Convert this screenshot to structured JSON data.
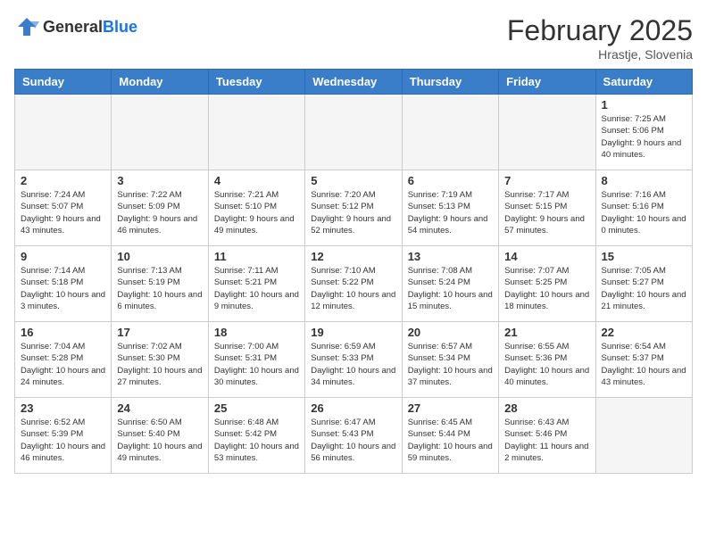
{
  "header": {
    "logo": {
      "general": "General",
      "blue": "Blue"
    },
    "title": "February 2025",
    "location": "Hrastje, Slovenia"
  },
  "weekdays": [
    "Sunday",
    "Monday",
    "Tuesday",
    "Wednesday",
    "Thursday",
    "Friday",
    "Saturday"
  ],
  "weeks": [
    [
      {
        "day": "",
        "info": ""
      },
      {
        "day": "",
        "info": ""
      },
      {
        "day": "",
        "info": ""
      },
      {
        "day": "",
        "info": ""
      },
      {
        "day": "",
        "info": ""
      },
      {
        "day": "",
        "info": ""
      },
      {
        "day": "1",
        "info": "Sunrise: 7:25 AM\nSunset: 5:06 PM\nDaylight: 9 hours and 40 minutes."
      }
    ],
    [
      {
        "day": "2",
        "info": "Sunrise: 7:24 AM\nSunset: 5:07 PM\nDaylight: 9 hours and 43 minutes."
      },
      {
        "day": "3",
        "info": "Sunrise: 7:22 AM\nSunset: 5:09 PM\nDaylight: 9 hours and 46 minutes."
      },
      {
        "day": "4",
        "info": "Sunrise: 7:21 AM\nSunset: 5:10 PM\nDaylight: 9 hours and 49 minutes."
      },
      {
        "day": "5",
        "info": "Sunrise: 7:20 AM\nSunset: 5:12 PM\nDaylight: 9 hours and 52 minutes."
      },
      {
        "day": "6",
        "info": "Sunrise: 7:19 AM\nSunset: 5:13 PM\nDaylight: 9 hours and 54 minutes."
      },
      {
        "day": "7",
        "info": "Sunrise: 7:17 AM\nSunset: 5:15 PM\nDaylight: 9 hours and 57 minutes."
      },
      {
        "day": "8",
        "info": "Sunrise: 7:16 AM\nSunset: 5:16 PM\nDaylight: 10 hours and 0 minutes."
      }
    ],
    [
      {
        "day": "9",
        "info": "Sunrise: 7:14 AM\nSunset: 5:18 PM\nDaylight: 10 hours and 3 minutes."
      },
      {
        "day": "10",
        "info": "Sunrise: 7:13 AM\nSunset: 5:19 PM\nDaylight: 10 hours and 6 minutes."
      },
      {
        "day": "11",
        "info": "Sunrise: 7:11 AM\nSunset: 5:21 PM\nDaylight: 10 hours and 9 minutes."
      },
      {
        "day": "12",
        "info": "Sunrise: 7:10 AM\nSunset: 5:22 PM\nDaylight: 10 hours and 12 minutes."
      },
      {
        "day": "13",
        "info": "Sunrise: 7:08 AM\nSunset: 5:24 PM\nDaylight: 10 hours and 15 minutes."
      },
      {
        "day": "14",
        "info": "Sunrise: 7:07 AM\nSunset: 5:25 PM\nDaylight: 10 hours and 18 minutes."
      },
      {
        "day": "15",
        "info": "Sunrise: 7:05 AM\nSunset: 5:27 PM\nDaylight: 10 hours and 21 minutes."
      }
    ],
    [
      {
        "day": "16",
        "info": "Sunrise: 7:04 AM\nSunset: 5:28 PM\nDaylight: 10 hours and 24 minutes."
      },
      {
        "day": "17",
        "info": "Sunrise: 7:02 AM\nSunset: 5:30 PM\nDaylight: 10 hours and 27 minutes."
      },
      {
        "day": "18",
        "info": "Sunrise: 7:00 AM\nSunset: 5:31 PM\nDaylight: 10 hours and 30 minutes."
      },
      {
        "day": "19",
        "info": "Sunrise: 6:59 AM\nSunset: 5:33 PM\nDaylight: 10 hours and 34 minutes."
      },
      {
        "day": "20",
        "info": "Sunrise: 6:57 AM\nSunset: 5:34 PM\nDaylight: 10 hours and 37 minutes."
      },
      {
        "day": "21",
        "info": "Sunrise: 6:55 AM\nSunset: 5:36 PM\nDaylight: 10 hours and 40 minutes."
      },
      {
        "day": "22",
        "info": "Sunrise: 6:54 AM\nSunset: 5:37 PM\nDaylight: 10 hours and 43 minutes."
      }
    ],
    [
      {
        "day": "23",
        "info": "Sunrise: 6:52 AM\nSunset: 5:39 PM\nDaylight: 10 hours and 46 minutes."
      },
      {
        "day": "24",
        "info": "Sunrise: 6:50 AM\nSunset: 5:40 PM\nDaylight: 10 hours and 49 minutes."
      },
      {
        "day": "25",
        "info": "Sunrise: 6:48 AM\nSunset: 5:42 PM\nDaylight: 10 hours and 53 minutes."
      },
      {
        "day": "26",
        "info": "Sunrise: 6:47 AM\nSunset: 5:43 PM\nDaylight: 10 hours and 56 minutes."
      },
      {
        "day": "27",
        "info": "Sunrise: 6:45 AM\nSunset: 5:44 PM\nDaylight: 10 hours and 59 minutes."
      },
      {
        "day": "28",
        "info": "Sunrise: 6:43 AM\nSunset: 5:46 PM\nDaylight: 11 hours and 2 minutes."
      },
      {
        "day": "",
        "info": ""
      }
    ]
  ]
}
